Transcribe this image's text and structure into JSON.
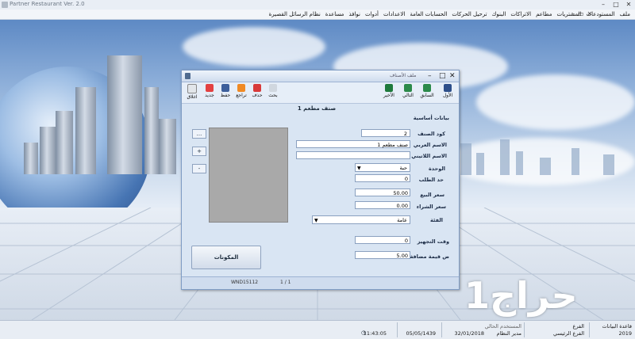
{
  "app": {
    "title": "Partner Restaurant Ver. 2.0"
  },
  "menu": [
    "ملف",
    "المستودعات",
    "المشتريات",
    "مطاعم",
    "الاتراكات",
    "البنوك",
    "ترحيل الحركات",
    "الحسابات العامة",
    "الاعدادات",
    "أدوات",
    "نوافذ",
    "مساعدة",
    "نظام الرسائل القصيرة"
  ],
  "window": {
    "title": "ملف الأصناف",
    "toolbar_right": [
      "الأول",
      "السابق",
      "التالي",
      "الأخير"
    ],
    "toolbar_left": [
      "بحث",
      "حذف",
      "تراجع",
      "حفظ",
      "جديد",
      "اغلاق"
    ],
    "record_header": "صنف مطعم 1",
    "section": "بيانات أساسية",
    "fields": {
      "code": {
        "label": "كود الصنف",
        "value": "2"
      },
      "name_ar": {
        "label": "الاسم العربي",
        "value": "صنف مطعم 1"
      },
      "name_en": {
        "label": "الاسم اللاتيني",
        "value": ""
      },
      "unit": {
        "label": "الوحدة",
        "value": "حبة"
      },
      "reorder": {
        "label": "حد الطلب",
        "value": "0"
      },
      "sale_price": {
        "label": "سعر البيع",
        "value": "50.00"
      },
      "buy_price": {
        "label": "سعر الشراء",
        "value": "0.00"
      },
      "category": {
        "label": "الفئة",
        "value": "عامة"
      },
      "prep_time": {
        "label": "وقت التجهيز",
        "value": "0"
      },
      "vat": {
        "label": "ض قيمة مضافة",
        "value": "5.00"
      }
    },
    "side_buttons": [
      "...",
      "+",
      "-"
    ],
    "components_button": "المكونات",
    "status_id": "WND15112",
    "status_page": "1 / 1"
  },
  "watermark": "حراج1",
  "statusbar": {
    "db_label": "قاعدة البيانات",
    "db_value": "2019",
    "branch_label": "الفرع",
    "branch_value": "الفرع الرئيسي",
    "user_label": "المستخدم الحالي",
    "user_value": "مدير النظام",
    "hijri": "05/05/1439",
    "gregorian": "32/01/2018",
    "time": "11:43:05"
  }
}
